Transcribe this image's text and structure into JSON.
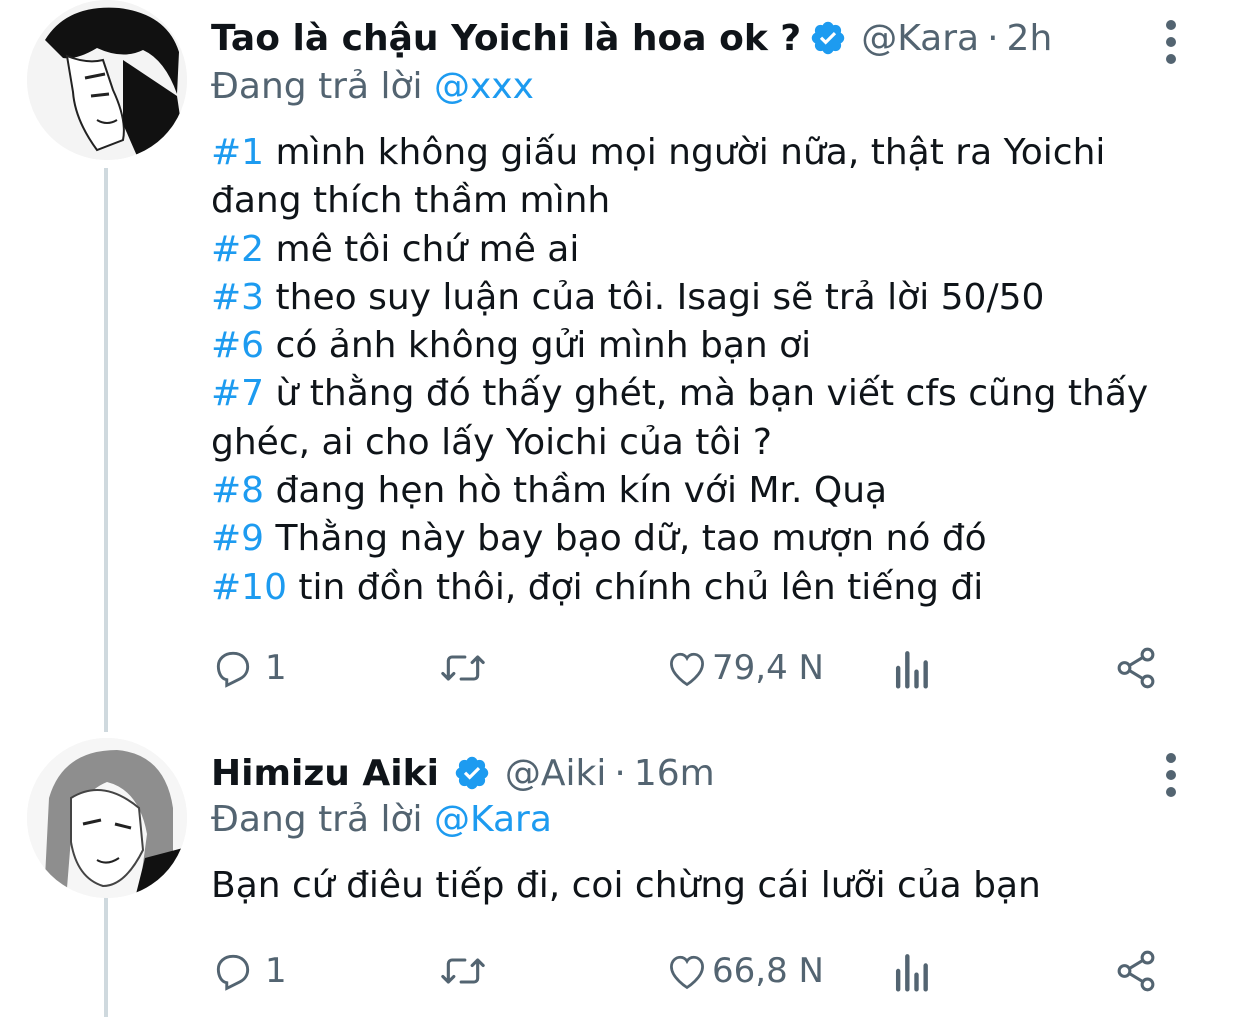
{
  "tweets": [
    {
      "display_name": "Tao là chậu Yoichi là hoa ok ?",
      "handle": "@Kara",
      "separator": "·",
      "time": "2h",
      "replying_prefix": "Đang trả lời",
      "replying_to": "@xxx",
      "lines": [
        {
          "tag": "#1",
          "text": " mình không giấu mọi người nữa, thật ra Yoichi"
        },
        {
          "tag": "",
          "text": "đang thích thầm mình"
        },
        {
          "tag": "#2",
          "text": " mê tôi chứ mê ai"
        },
        {
          "tag": "#3",
          "text": " theo suy luận của tôi. Isagi sẽ trả lời 50/50"
        },
        {
          "tag": "#6",
          "text": " có ảnh không gửi mình bạn ơi"
        },
        {
          "tag": "#7",
          "text": " ừ thằng đó thấy ghét, mà bạn viết cfs cũng thấy"
        },
        {
          "tag": "",
          "text": "ghéc, ai cho lấy Yoichi của tôi ?"
        },
        {
          "tag": "#8",
          "text": " đang hẹn hò thầm kín với Mr. Quạ"
        },
        {
          "tag": "#9",
          "text": " Thằng này bay bạo dữ, tao mượn nó đó"
        },
        {
          "tag": "#10",
          "text": " tin đồn thôi, đợi chính chủ lên tiếng đi"
        }
      ],
      "reply_count": "1",
      "like_count": "79,4 N"
    },
    {
      "display_name": "Himizu Aiki",
      "handle": "@Aiki",
      "separator": "·",
      "time": "16m",
      "replying_prefix": "Đang trả lời",
      "replying_to": "@Kara",
      "lines": [
        {
          "tag": "",
          "text": "Bạn cứ điêu tiếp đi, coi chừng cái lưỡi của bạn"
        }
      ],
      "reply_count": "1",
      "like_count": "66,8 N"
    }
  ],
  "icons": {
    "verified": "verified-badge-icon",
    "more": "more-vertical-icon",
    "reply": "reply-icon",
    "retweet": "retweet-icon",
    "like": "heart-icon",
    "views": "analytics-icon",
    "share": "share-icon"
  },
  "colors": {
    "accent": "#1d9bf0",
    "text": "#0f1419",
    "secondary": "#536471",
    "thread_line": "#cfd9de"
  }
}
